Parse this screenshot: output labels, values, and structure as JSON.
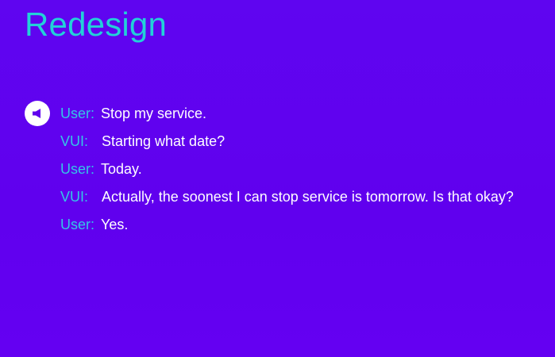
{
  "slide": {
    "title": "Redesign"
  },
  "icons": {
    "speaker": "speaker-icon"
  },
  "dialog": [
    {
      "speaker": "User:",
      "text": "Stop my service."
    },
    {
      "speaker": "VUI:",
      "text": "Starting what date?"
    },
    {
      "speaker": "User:",
      "text": "Today."
    },
    {
      "speaker": "VUI:",
      "text": "Actually, the soonest I can stop service is tomorrow.  Is that okay?"
    },
    {
      "speaker": "User:",
      "text": "Yes."
    }
  ],
  "colors": {
    "background": "#6000ee",
    "title": "#22d1d8",
    "speaker_label": "#34c6e6",
    "speech_text": "#ffffff",
    "icon_background": "#ffffff",
    "icon_glyph": "#6000ee"
  }
}
